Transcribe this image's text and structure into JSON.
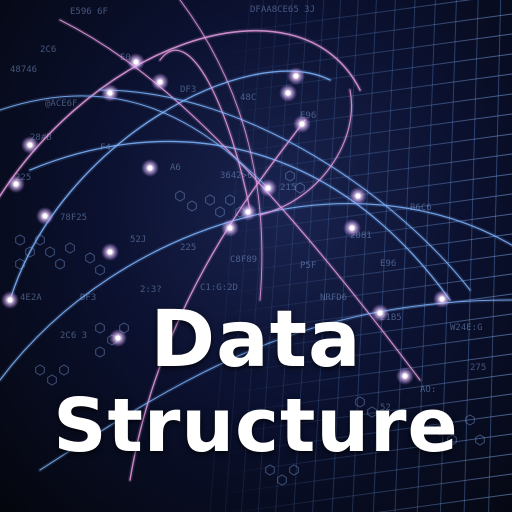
{
  "title": {
    "line1": "Data",
    "line2": "Structure"
  },
  "colors": {
    "background": "#05070f",
    "grid": "#5a86c8",
    "arc_pink": "#e79be0",
    "arc_blue": "#7fb6ff",
    "node_glow": "#ffffff",
    "text": "#ffffff"
  },
  "decor": {
    "hex_codes": [
      "E596 6F",
      "DFAA8CE65 3J",
      "2C6",
      "48746",
      "E0",
      "@ACE6F",
      "DF3",
      "48C",
      "E96",
      "28#B",
      "F4",
      "A6",
      "3642>6",
      "215",
      "225",
      "78F25",
      "52J",
      "225",
      "C8F89",
      "P5F",
      "2881",
      "E96",
      "B6C6",
      "4E2A",
      "DF3",
      "2:3?",
      "C1:G:2D",
      "NRFD6",
      "21B5",
      "W24E:G",
      "275",
      "AO:",
      "52",
      "2C6 3"
    ]
  }
}
